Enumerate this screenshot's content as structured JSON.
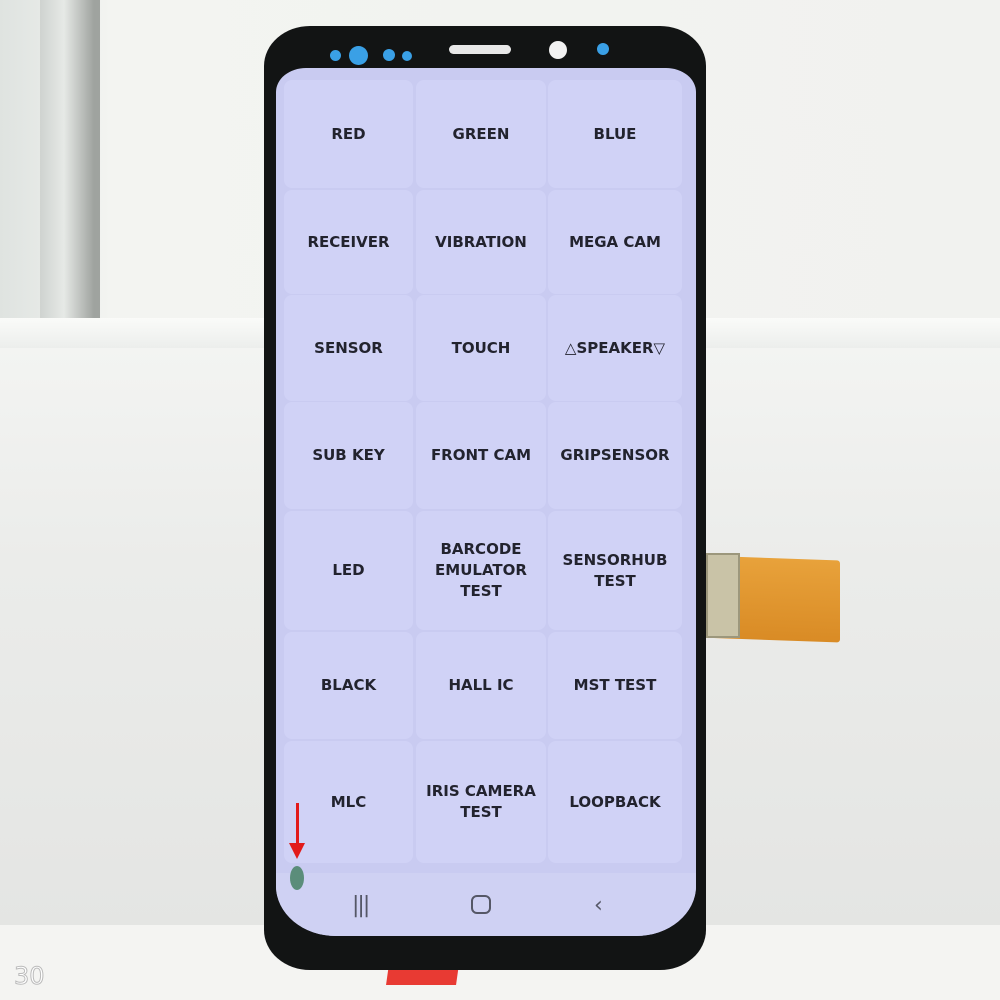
{
  "test_menu": {
    "items": [
      [
        "RED",
        "GREEN",
        "BLUE"
      ],
      [
        "RECEIVER",
        "VIBRATION",
        "MEGA CAM"
      ],
      [
        "SENSOR",
        "TOUCH",
        "△SPEAKER▽"
      ],
      [
        "SUB KEY",
        "FRONT CAM",
        "GRIPSENSOR"
      ],
      [
        "LED",
        "BARCODE EMULATOR TEST",
        "SENSORHUB TEST"
      ],
      [
        "BLACK",
        "HALL IC",
        "MST TEST"
      ],
      [
        "MLC",
        "IRIS CAMERA TEST",
        "LOOPBACK"
      ]
    ]
  },
  "nav_bar": {
    "recents_icon": "recents-icon",
    "home_icon": "home-icon",
    "back_icon": "back-icon"
  },
  "frame_number": "30",
  "colors": {
    "screen": "#c9cbf1",
    "tile": "#d0d2f6",
    "annotation_arrow": "#e21a1a",
    "phone_body": "#121414"
  }
}
